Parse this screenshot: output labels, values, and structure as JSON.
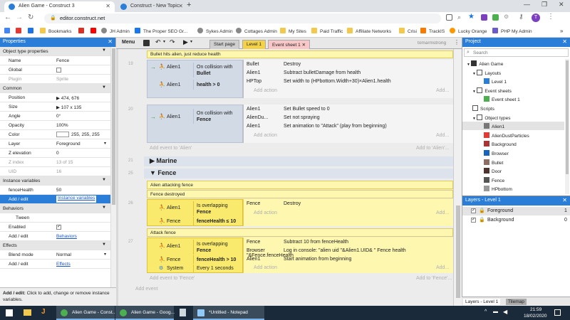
{
  "browser": {
    "tabs": [
      {
        "title": "Alien Game - Construct 3",
        "active": true
      },
      {
        "title": "Construct - New Topic",
        "active": false
      }
    ],
    "url": "editor.construct.net",
    "avatar_letter": "T",
    "bookmarks": [
      "Apps",
      "Bookmarks",
      "JH Admin",
      "The Proper SEO Gr...",
      "Sykes Admin",
      "Cottages Admin",
      "My Sites",
      "Paid Traffic",
      "Affiliate Networks",
      "Crisi",
      "TrackIS",
      "Lucky Orange",
      "PHP My Admin"
    ]
  },
  "properties": {
    "title": "Properties",
    "rows": [
      {
        "k": "Object type properties",
        "v": "",
        "type": "sec"
      },
      {
        "k": "Name",
        "v": "Fence",
        "type": ""
      },
      {
        "k": "Global",
        "v": "",
        "type": "chk"
      },
      {
        "k": "Plugin",
        "v": "Sprite",
        "type": "dim"
      },
      {
        "k": "Common",
        "v": "",
        "type": "sec"
      },
      {
        "k": "Position",
        "v": "▶ 474, 676",
        "type": ""
      },
      {
        "k": "Size",
        "v": "▶ 107 x 135",
        "type": ""
      },
      {
        "k": "Angle",
        "v": "0°",
        "type": ""
      },
      {
        "k": "Opacity",
        "v": "100%",
        "type": ""
      },
      {
        "k": "Color",
        "v": "255, 255, 255",
        "type": "color"
      },
      {
        "k": "Layer",
        "v": "Foreground",
        "type": "select"
      },
      {
        "k": "Z elevation",
        "v": "0",
        "type": ""
      },
      {
        "k": "Z index",
        "v": "13 of 15",
        "type": "dim"
      },
      {
        "k": "UID",
        "v": "16",
        "type": "dim"
      },
      {
        "k": "Instance variables",
        "v": "",
        "type": "sec"
      },
      {
        "k": "fenceHealth",
        "v": "50",
        "type": ""
      },
      {
        "k": "Add / edit",
        "v": "Instance variables",
        "type": "selected"
      },
      {
        "k": "Behaviors",
        "v": "",
        "type": "sec"
      },
      {
        "k": "Tween",
        "v": "",
        "type": "sub"
      },
      {
        "k": "Enabled",
        "v": "",
        "type": "chkon"
      },
      {
        "k": "Add / edit",
        "v": "Behaviors",
        "type": "link"
      },
      {
        "k": "Effects",
        "v": "",
        "type": "sec"
      },
      {
        "k": "Blend mode",
        "v": "Normal",
        "type": "select"
      },
      {
        "k": "Add / edit",
        "v": "Effects",
        "type": "link"
      }
    ],
    "footer_bold": "Add / edit:",
    "footer_text": " Click to add, change or remove instance variables."
  },
  "editor": {
    "menu_label": "Menu",
    "tabs": [
      "Start page",
      "Level 1",
      "Event sheet 1"
    ],
    "user": "tomarmstrong",
    "top_comment": "Bullet hits alien, just reduce health",
    "events": {
      "e19": {
        "num": "19",
        "obj1": "Alien1",
        "cond1": "On collision with",
        "cond1b": "Bullet",
        "obj2": "Alien1",
        "cond2": "health > 0",
        "actions": [
          {
            "obj": "Bullet",
            "text": "Destroy"
          },
          {
            "obj": "Alien1",
            "text": "Subtract bulletDamage from health"
          },
          {
            "obj": "HPTop",
            "text": "Set width to (HPbottom.Width+30)×Alien1.health"
          }
        ]
      },
      "e20": {
        "num": "20",
        "obj1": "Alien1",
        "cond1": "On collision with",
        "cond1b": "Fence",
        "actions": [
          {
            "obj": "Alien1",
            "text": "Set Bullet speed to 0"
          },
          {
            "obj": "AlienDu...",
            "text": "Set not spraying"
          },
          {
            "obj": "Alien1",
            "text": "Set animation to \"Attack\" (play from beginning)"
          }
        ]
      }
    },
    "add_event_alien": "Add event to 'Alien'",
    "add_to_alien": "Add to 'Alien'...",
    "add_action": "Add action",
    "group_marine": {
      "num": "21",
      "label": "Marine"
    },
    "group_fence": {
      "num": "25",
      "label": "Fence"
    },
    "fence_comment1": "Alien attacking fence",
    "fence_comment2": "Fence destroyed",
    "e26": {
      "num": "26",
      "obj1": "Alien1",
      "cond1": "Is overlapping",
      "cond1b": "Fence",
      "obj2": "Fence",
      "cond2": "fenceHealth ≤ 10",
      "actions": [
        {
          "obj": "Fence",
          "text": "Destroy"
        }
      ]
    },
    "fence_comment3": "Attack fence",
    "e27": {
      "num": "27",
      "obj1": "Alien1",
      "cond1": "Is overlapping",
      "cond1b": "Fence",
      "obj2": "Fence",
      "cond2": "fenceHealth > 10",
      "obj3": "System",
      "cond3": "Every 1 seconds",
      "actions": [
        {
          "obj": "Fence",
          "text": "Subtract 10 from fenceHealth"
        },
        {
          "obj": "Browser",
          "text": "Log in console: \"alien uid \"&Alien1.UID& \" Fence health \"&Fence.fenceHealth"
        },
        {
          "obj": "Alien1",
          "text": "Start animation from beginning"
        }
      ]
    },
    "add_event_fence": "Add event to 'Fence'",
    "add_to_fence": "Add to 'Fence'...",
    "add_event": "Add event"
  },
  "project": {
    "title": "Project",
    "search_placeholder": "Search",
    "items": [
      "Alien Game",
      "Layouts",
      "Level 1",
      "Event sheets",
      "Event sheet 1",
      "Scripts",
      "Object types",
      "Alien1",
      "AlienDustParticles",
      "Background",
      "Browser",
      "Bullet",
      "Door",
      "Fence",
      "HPbottom"
    ]
  },
  "layers": {
    "title": "Layers - Level 1",
    "items": [
      {
        "name": "Foreground",
        "n": "1"
      },
      {
        "name": "Background",
        "n": "0"
      }
    ],
    "tabs": [
      "Layers - Level 1",
      "Tilemap"
    ]
  },
  "taskbar": {
    "items": [
      "Alien Game - Const...",
      "Alien Game - Goog...",
      "*Untitled - Notepad"
    ],
    "time": "21:59",
    "date": "18/02/2020"
  },
  "colors": {
    "accent": "#2a7ed8",
    "comment": "#fef7b0",
    "condition": "#d2dae6"
  }
}
